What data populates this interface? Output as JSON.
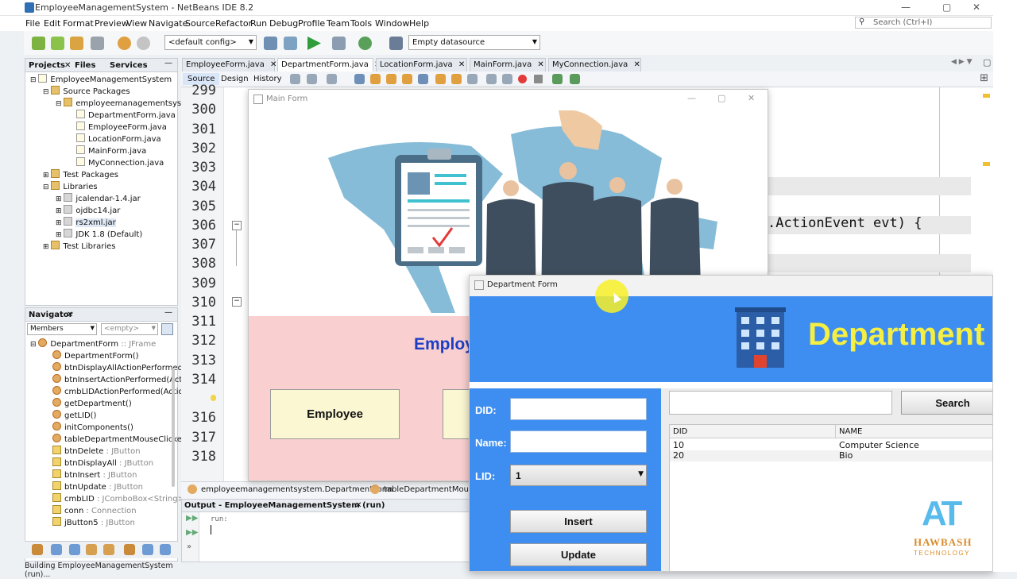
{
  "window": {
    "title": "EmployeeManagementSystem - NetBeans IDE 8.2",
    "controls": {
      "minimize": "—",
      "maximize": "▢",
      "close": "✕"
    }
  },
  "menu": [
    "File",
    "Edit",
    "Format",
    "Preview",
    "View",
    "Navigate",
    "Source",
    "Refactor",
    "Run",
    "Debug",
    "Profile",
    "Team",
    "Tools",
    "Window",
    "Help"
  ],
  "search": {
    "placeholder": "Search (Ctrl+I)"
  },
  "toolbar": {
    "config": "<default config>",
    "datasource": "Empty datasource"
  },
  "projects": {
    "tabs": [
      "Projects",
      "Files",
      "Services"
    ],
    "tree": [
      {
        "label": "EmployeeManagementSystem",
        "icon": "project-icon"
      },
      {
        "label": "Source Packages",
        "icon": "folder-icon"
      },
      {
        "label": "employeemanagementsystem",
        "icon": "package-icon"
      },
      {
        "label": "DepartmentForm.java",
        "icon": "java-file-icon"
      },
      {
        "label": "EmployeeForm.java",
        "icon": "java-file-icon"
      },
      {
        "label": "LocationForm.java",
        "icon": "java-file-icon"
      },
      {
        "label": "MainForm.java",
        "icon": "java-file-icon"
      },
      {
        "label": "MyConnection.java",
        "icon": "java-file-icon"
      },
      {
        "label": "Test Packages",
        "icon": "folder-icon"
      },
      {
        "label": "Libraries",
        "icon": "folder-icon"
      },
      {
        "label": "jcalendar-1.4.jar",
        "icon": "jar-icon"
      },
      {
        "label": "ojdbc14.jar",
        "icon": "jar-icon"
      },
      {
        "label": "rs2xml.jar",
        "icon": "jar-icon"
      },
      {
        "label": "JDK 1.8 (Default)",
        "icon": "jdk-icon"
      },
      {
        "label": "Test Libraries",
        "icon": "folder-icon"
      }
    ]
  },
  "navigator": {
    "title": "Navigator",
    "filter": "Members",
    "empty": "<empty>",
    "items": [
      {
        "name": "DepartmentForm",
        "type": " :: JFrame"
      },
      {
        "name": "DepartmentForm()",
        "type": ""
      },
      {
        "name": "btnDisplayAllActionPerformed(A",
        "type": ""
      },
      {
        "name": "btnInsertActionPerformed(Actio",
        "type": ""
      },
      {
        "name": "cmbLIDActionPerformed(Action",
        "type": ""
      },
      {
        "name": "getDepartment()",
        "type": ""
      },
      {
        "name": "getLID()",
        "type": ""
      },
      {
        "name": "initComponents()",
        "type": ""
      },
      {
        "name": "tableDepartmentMouseClicked(",
        "type": ""
      },
      {
        "name": "btnDelete",
        "type": " : JButton"
      },
      {
        "name": "btnDisplayAll",
        "type": " : JButton"
      },
      {
        "name": "btnInsert",
        "type": " : JButton"
      },
      {
        "name": "btnUpdate",
        "type": " : JButton"
      },
      {
        "name": "cmbLID",
        "type": " : JComboBox<String>"
      },
      {
        "name": "conn",
        "type": " : Connection"
      },
      {
        "name": "jButton5",
        "type": " : JButton"
      }
    ]
  },
  "editor": {
    "tabs": [
      "EmployeeForm.java",
      "DepartmentForm.java",
      "LocationForm.java",
      "MainForm.java",
      "MyConnection.java"
    ],
    "subtabs": [
      "Source",
      "Design",
      "History"
    ],
    "line_numbers": [
      "299",
      "300",
      "301",
      "302",
      "303",
      "304",
      "305",
      "306",
      "307",
      "308",
      "309",
      "310",
      "311",
      "312",
      "313",
      "314",
      "316",
      "317",
      "318"
    ],
    "code_visible": ".ActionEvent evt) {",
    "breadcrumb": [
      "employeemanagementsystem.DepartmentForm",
      "tableDepartmentMouseClic"
    ]
  },
  "output": {
    "title": "Output - EmployeeManagementSystem (run)",
    "text": "run:"
  },
  "status": "Building EmployeeManagementSystem (run)...",
  "main_form": {
    "title": "Main Form",
    "heading": "Employ",
    "employee_button": "Employee"
  },
  "department_form": {
    "title": "Department Form",
    "banner": "Department",
    "labels": {
      "did": "DID:",
      "name": "Name:",
      "lid": "LID:"
    },
    "lid_selected": "1",
    "buttons": {
      "insert": "Insert",
      "update": "Update",
      "search": "Search"
    },
    "table": {
      "columns": [
        "DID",
        "NAME"
      ],
      "rows": [
        [
          "10",
          "Computer Science"
        ],
        [
          "20",
          "Bio"
        ]
      ]
    }
  },
  "watermark": {
    "brand": "HAWBASH",
    "sub": "TECHNOLOGY",
    "logo": "AT"
  },
  "colors": {
    "dept_blue": "#3d8ef0",
    "dept_yellow": "#f5ee43",
    "main_pink": "#f9cfd0",
    "heading_blue": "#1c3fc6"
  }
}
